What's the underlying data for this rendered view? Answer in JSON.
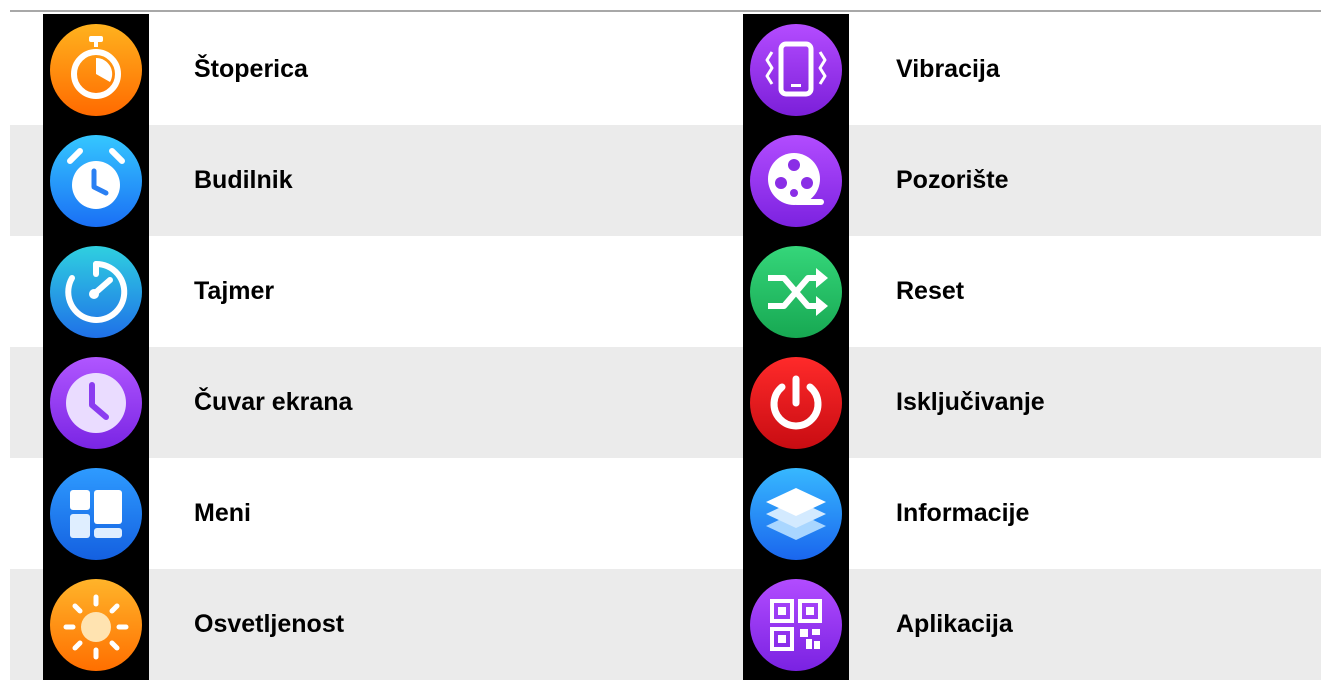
{
  "items": [
    {
      "label": "Štoperica",
      "icon": "stopwatch-icon"
    },
    {
      "label": "Vibracija",
      "icon": "vibration-icon"
    },
    {
      "label": "Budilnik",
      "icon": "alarm-clock-icon"
    },
    {
      "label": "Pozorište",
      "icon": "theater-film-reel-icon"
    },
    {
      "label": "Tajmer",
      "icon": "timer-icon"
    },
    {
      "label": "Reset",
      "icon": "shuffle-reset-icon"
    },
    {
      "label": "Čuvar ekrana",
      "icon": "screensaver-clock-icon"
    },
    {
      "label": "Isključivanje",
      "icon": "power-icon"
    },
    {
      "label": "Meni",
      "icon": "menu-grid-icon"
    },
    {
      "label": "Informacije",
      "icon": "layers-info-icon"
    },
    {
      "label": "Osvetljenost",
      "icon": "brightness-sun-icon"
    },
    {
      "label": "Aplikacija",
      "icon": "qr-code-app-icon"
    }
  ],
  "colors": {
    "row_shade": "#ebebeb",
    "icon_background": "#000000",
    "rule": "#a8a8a8"
  }
}
